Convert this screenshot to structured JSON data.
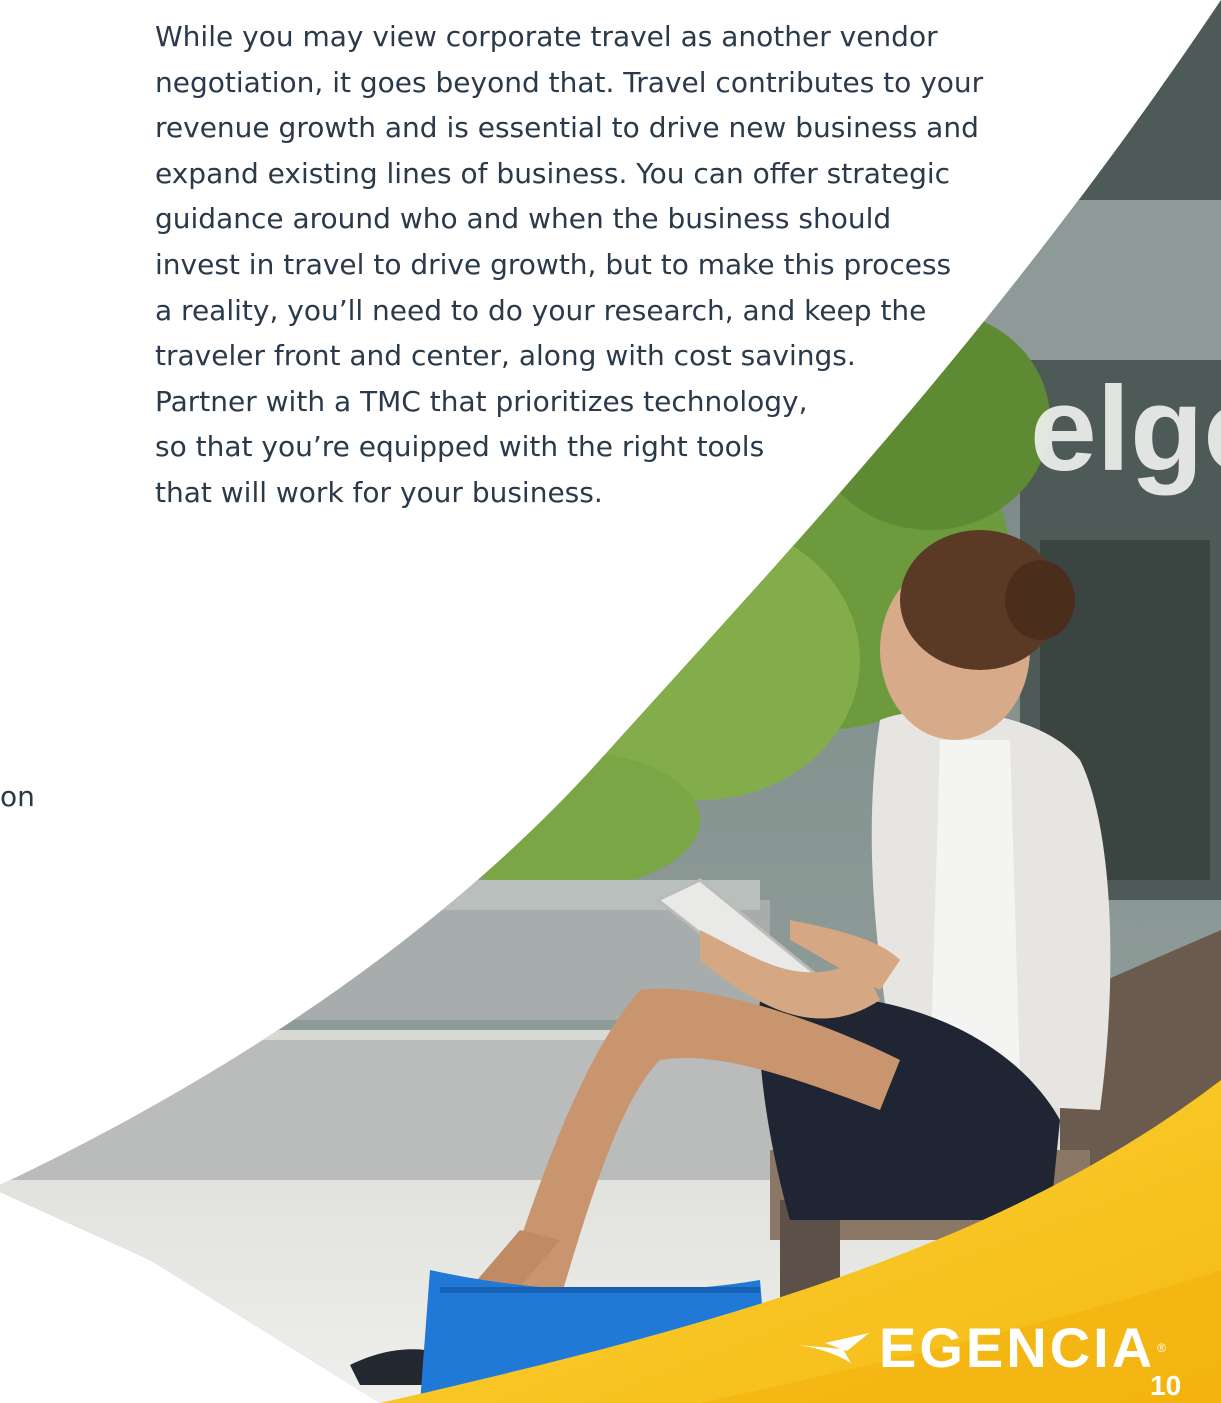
{
  "body": {
    "lines": [
      "While you may view corporate travel as another vendor",
      "negotiation, it goes beyond that. Travel contributes to your",
      "revenue growth and is essential to drive new business and",
      "expand existing lines of business. You can offer strategic",
      "guidance around who and when the business should",
      "invest in travel to drive growth, but to make this process",
      "a reality, you’ll need to do your research, and keep the",
      "traveler front and center, along with cost savings.",
      "Partner with a TMC that prioritizes technology,",
      "so that you’re equipped with the right tools",
      "that will work for your business."
    ]
  },
  "margin_fragment": "on",
  "photo_sign_text": "elgo",
  "brand": {
    "name": "EGENCIA",
    "reg_mark": "®"
  },
  "page_number": "10",
  "colors": {
    "text": "#2b3a4a",
    "brand_yellow": "#f8c21c",
    "background": "#ffffff"
  },
  "icons": [
    "egencia-swoosh-icon"
  ]
}
